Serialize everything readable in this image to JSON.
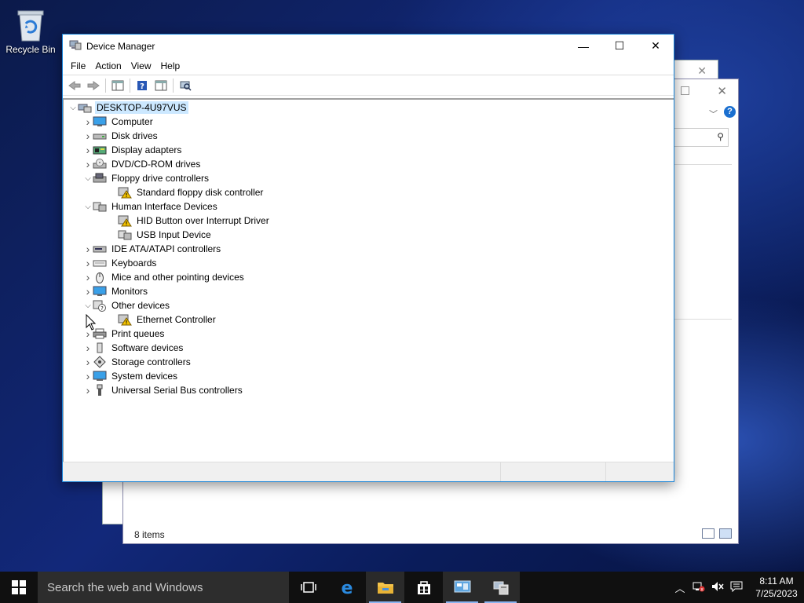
{
  "desktop": {
    "recycle_bin_label": "Recycle Bin"
  },
  "bg_window": {
    "items_count": "8 items"
  },
  "window": {
    "title": "Device Manager",
    "menu": [
      "File",
      "Action",
      "View",
      "Help"
    ]
  },
  "tree": [
    {
      "label": "DESKTOP-4U97VUS",
      "level": 0,
      "expander": "expanded",
      "icon": "computer-root-icon",
      "selected": true
    },
    {
      "label": "Computer",
      "level": 1,
      "expander": "collapsed",
      "icon": "monitor-icon"
    },
    {
      "label": "Disk drives",
      "level": 1,
      "expander": "collapsed",
      "icon": "disk-drive-icon"
    },
    {
      "label": "Display adapters",
      "level": 1,
      "expander": "collapsed",
      "icon": "display-adapter-icon"
    },
    {
      "label": "DVD/CD-ROM drives",
      "level": 1,
      "expander": "collapsed",
      "icon": "dvd-icon"
    },
    {
      "label": "Floppy drive controllers",
      "level": 1,
      "expander": "expanded",
      "icon": "floppy-controller-icon"
    },
    {
      "label": "Standard floppy disk controller",
      "level": 2,
      "expander": "none",
      "icon": "warning-device-icon"
    },
    {
      "label": "Human Interface Devices",
      "level": 1,
      "expander": "expanded",
      "icon": "hid-icon"
    },
    {
      "label": "HID Button over Interrupt Driver",
      "level": 2,
      "expander": "none",
      "icon": "warning-device-icon"
    },
    {
      "label": "USB Input Device",
      "level": 2,
      "expander": "none",
      "icon": "hid-device-icon"
    },
    {
      "label": "IDE ATA/ATAPI controllers",
      "level": 1,
      "expander": "collapsed",
      "icon": "ide-controller-icon"
    },
    {
      "label": "Keyboards",
      "level": 1,
      "expander": "collapsed",
      "icon": "keyboard-icon"
    },
    {
      "label": "Mice and other pointing devices",
      "level": 1,
      "expander": "collapsed",
      "icon": "mouse-icon"
    },
    {
      "label": "Monitors",
      "level": 1,
      "expander": "collapsed",
      "icon": "monitor-icon"
    },
    {
      "label": "Other devices",
      "level": 1,
      "expander": "expanded",
      "icon": "unknown-device-icon"
    },
    {
      "label": "Ethernet Controller",
      "level": 2,
      "expander": "none",
      "icon": "warning-device-icon"
    },
    {
      "label": "Print queues",
      "level": 1,
      "expander": "collapsed",
      "icon": "printer-icon"
    },
    {
      "label": "Software devices",
      "level": 1,
      "expander": "collapsed",
      "icon": "software-device-icon"
    },
    {
      "label": "Storage controllers",
      "level": 1,
      "expander": "collapsed",
      "icon": "storage-controller-icon"
    },
    {
      "label": "System devices",
      "level": 1,
      "expander": "collapsed",
      "icon": "system-device-icon"
    },
    {
      "label": "Universal Serial Bus controllers",
      "level": 1,
      "expander": "collapsed",
      "icon": "usb-icon"
    }
  ],
  "taskbar": {
    "search_placeholder": "Search the web and Windows",
    "clock_time": "8:11 AM",
    "clock_date": "7/25/2023"
  },
  "colors": {
    "accent": "#1883d7",
    "selection": "#cce8ff",
    "taskbar": "#101010"
  }
}
